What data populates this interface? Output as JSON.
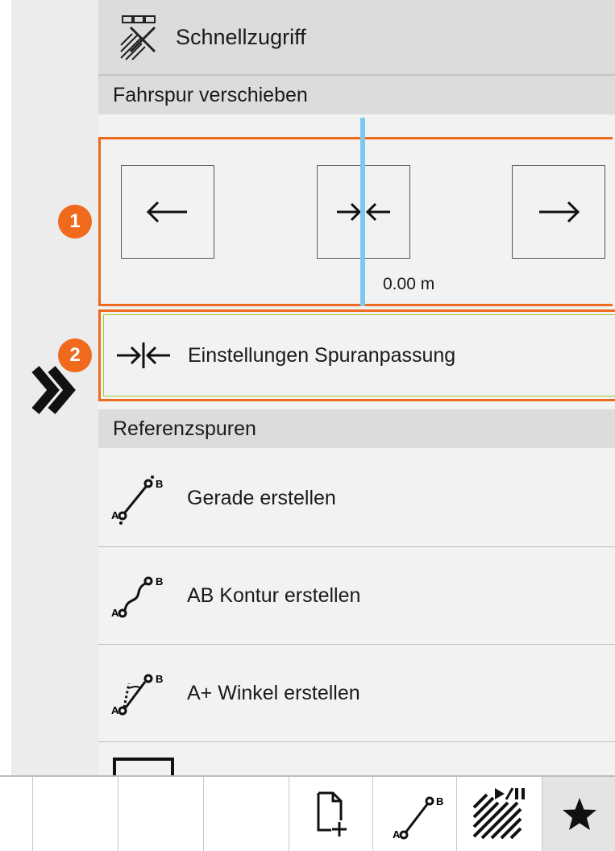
{
  "panel": {
    "title": "Schnellzugriff",
    "section_shift": "Fahrspur verschieben",
    "shift_readout": "0.00 m",
    "adjust_label": "Einstellungen Spuranpassung",
    "section_reference": "Referenzspuren",
    "reference_items": [
      {
        "label": "Gerade erstellen",
        "icon": "ab-line-icon"
      },
      {
        "label": "AB Kontur erstellen",
        "icon": "ab-contour-icon"
      },
      {
        "label": "A+ Winkel erstellen",
        "icon": "a-plus-angle-icon"
      }
    ]
  },
  "badges": {
    "one": "1",
    "two": "2"
  },
  "icon_letters": {
    "a": "A",
    "b": "B"
  },
  "toolbar": {
    "items": [
      "new-document-icon",
      "ab-line-icon",
      "record-pause-icon",
      "favorites-star-icon"
    ]
  },
  "colors": {
    "highlight": "#f06a1e",
    "inner_highlight": "#9ccc2c",
    "guide_line": "#7ec8f0"
  }
}
